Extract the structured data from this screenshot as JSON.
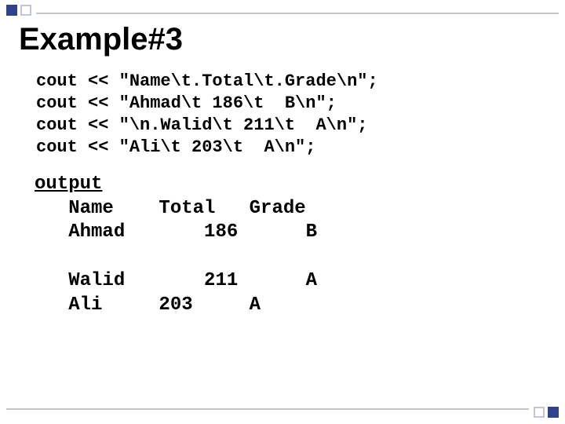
{
  "title": "Example#3",
  "code": {
    "lines": [
      "cout << \"Name\\t.Total\\t.Grade\\n\";",
      "cout << \"Ahmad\\t 186\\t  B\\n\";",
      "cout << \"\\n.Walid\\t 211\\t  A\\n\";",
      "cout << \"Ali\\t 203\\t  A\\n\";"
    ]
  },
  "output": {
    "label": "output",
    "lines": [
      "   Name    Total   Grade",
      "   Ahmad       186      B",
      "",
      "   Walid       211      A",
      "   Ali     203     A"
    ]
  }
}
